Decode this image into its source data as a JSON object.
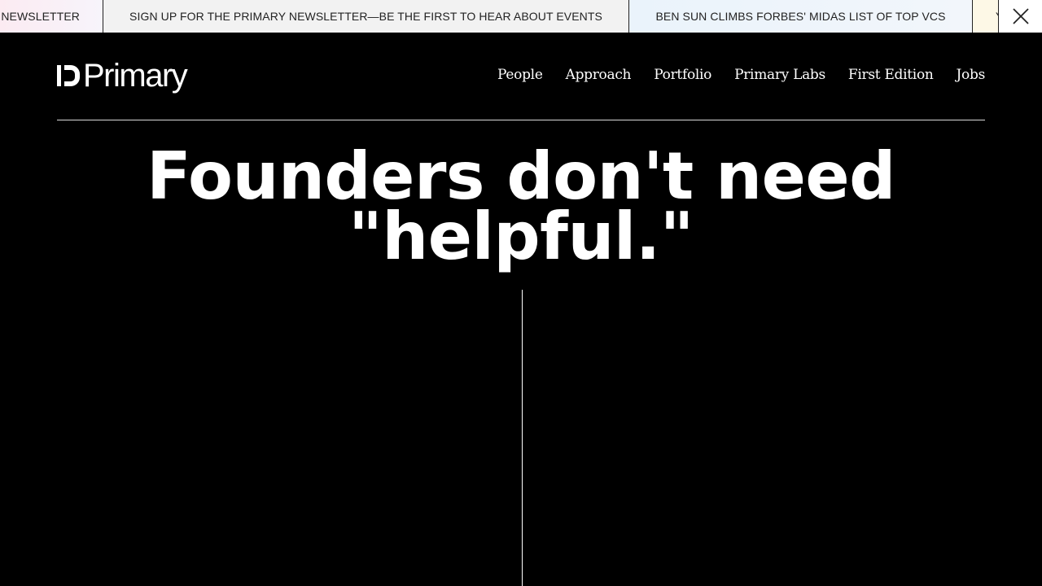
{
  "ticker": {
    "items": [
      {
        "label": "NEWSLETTER"
      },
      {
        "label": "SIGN UP FOR THE PRIMARY NEWSLETTER—BE THE FIRST TO HEAR ABOUT EVENTS"
      },
      {
        "label": "BEN SUN CLIMBS FORBES' MIDAS LIST OF TOP VCS"
      },
      {
        "label": "Y"
      }
    ]
  },
  "header": {
    "logo_text": "Primary",
    "nav": [
      {
        "label": "People"
      },
      {
        "label": "Approach"
      },
      {
        "label": "Portfolio"
      },
      {
        "label": "Primary Labs"
      },
      {
        "label": "First Edition"
      },
      {
        "label": "Jobs"
      }
    ]
  },
  "hero": {
    "line1": "Founders don't need",
    "line2": "\"helpful.\""
  },
  "colors": {
    "background": "#000000",
    "text": "#ffffff",
    "ticker_bg": "#f2f2f2"
  }
}
